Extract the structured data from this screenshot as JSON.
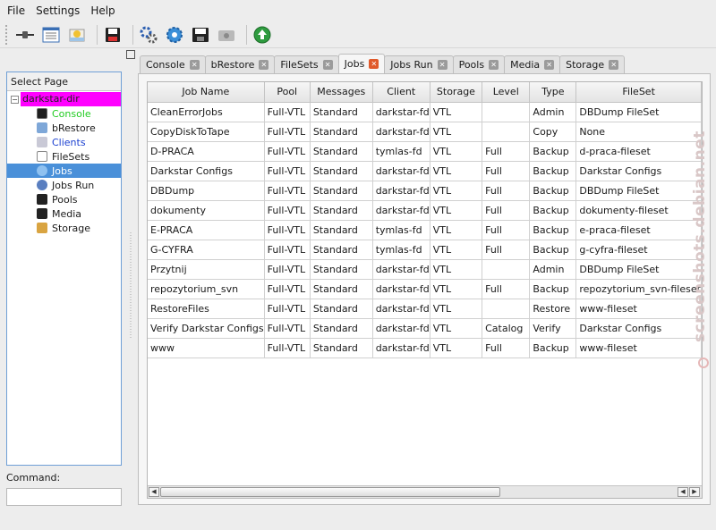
{
  "menu": [
    "File",
    "Settings",
    "Help"
  ],
  "toolbar": {
    "icons": [
      "connect-icon",
      "list-icon",
      "restore-icon",
      "save-icon",
      "run-job-icon",
      "estimate-icon",
      "label-icon",
      "media-icon",
      "status-icon"
    ]
  },
  "left": {
    "header": "Select Page",
    "root": "darkstar-dir",
    "items": [
      {
        "label": "Console",
        "color": "#22cc22"
      },
      {
        "label": "bRestore",
        "color": "#1a1a1a"
      },
      {
        "label": "Clients",
        "color": "#1a3fd0"
      },
      {
        "label": "FileSets",
        "color": "#1a1a1a"
      },
      {
        "label": "Jobs",
        "color": "#ffffff"
      },
      {
        "label": "Jobs Run",
        "color": "#1a1a1a"
      },
      {
        "label": "Pools",
        "color": "#1a1a1a"
      },
      {
        "label": "Media",
        "color": "#1a1a1a"
      },
      {
        "label": "Storage",
        "color": "#1a1a1a"
      }
    ],
    "command_label": "Command:"
  },
  "tabs": [
    "Console",
    "bRestore",
    "FileSets",
    "Jobs",
    "Jobs Run",
    "Pools",
    "Media",
    "Storage"
  ],
  "table": {
    "headers": [
      "Job Name",
      "Pool",
      "Messages",
      "Client",
      "Storage",
      "Level",
      "Type",
      "FileSet"
    ],
    "rows": [
      [
        "CleanErrorJobs",
        "Full-VTL",
        "Standard",
        "darkstar-fd",
        "VTL",
        "",
        "Admin",
        "DBDump FileSet"
      ],
      [
        "CopyDiskToTape",
        "Full-VTL",
        "Standard",
        "darkstar-fd",
        "VTL",
        "",
        "Copy",
        "None"
      ],
      [
        "D-PRACA",
        "Full-VTL",
        "Standard",
        "tymlas-fd",
        "VTL",
        "Full",
        "Backup",
        "d-praca-fileset"
      ],
      [
        "Darkstar Configs",
        "Full-VTL",
        "Standard",
        "darkstar-fd",
        "VTL",
        "Full",
        "Backup",
        "Darkstar Configs"
      ],
      [
        "DBDump",
        "Full-VTL",
        "Standard",
        "darkstar-fd",
        "VTL",
        "Full",
        "Backup",
        "DBDump FileSet"
      ],
      [
        "dokumenty",
        "Full-VTL",
        "Standard",
        "darkstar-fd",
        "VTL",
        "Full",
        "Backup",
        "dokumenty-fileset"
      ],
      [
        "E-PRACA",
        "Full-VTL",
        "Standard",
        "tymlas-fd",
        "VTL",
        "Full",
        "Backup",
        "e-praca-fileset"
      ],
      [
        "G-CYFRA",
        "Full-VTL",
        "Standard",
        "tymlas-fd",
        "VTL",
        "Full",
        "Backup",
        "g-cyfra-fileset"
      ],
      [
        "Przytnij",
        "Full-VTL",
        "Standard",
        "darkstar-fd",
        "VTL",
        "",
        "Admin",
        "DBDump FileSet"
      ],
      [
        "repozytorium_svn",
        "Full-VTL",
        "Standard",
        "darkstar-fd",
        "VTL",
        "Full",
        "Backup",
        "repozytorium_svn-fileset"
      ],
      [
        "RestoreFiles",
        "Full-VTL",
        "Standard",
        "darkstar-fd",
        "VTL",
        "",
        "Restore",
        "www-fileset"
      ],
      [
        "Verify Darkstar Configs",
        "Full-VTL",
        "Standard",
        "darkstar-fd",
        "VTL",
        "Catalog",
        "Verify",
        "Darkstar Configs"
      ],
      [
        "www",
        "Full-VTL",
        "Standard",
        "darkstar-fd",
        "VTL",
        "Full",
        "Backup",
        "www-fileset"
      ]
    ]
  },
  "watermark": "screenshots.debian.net"
}
